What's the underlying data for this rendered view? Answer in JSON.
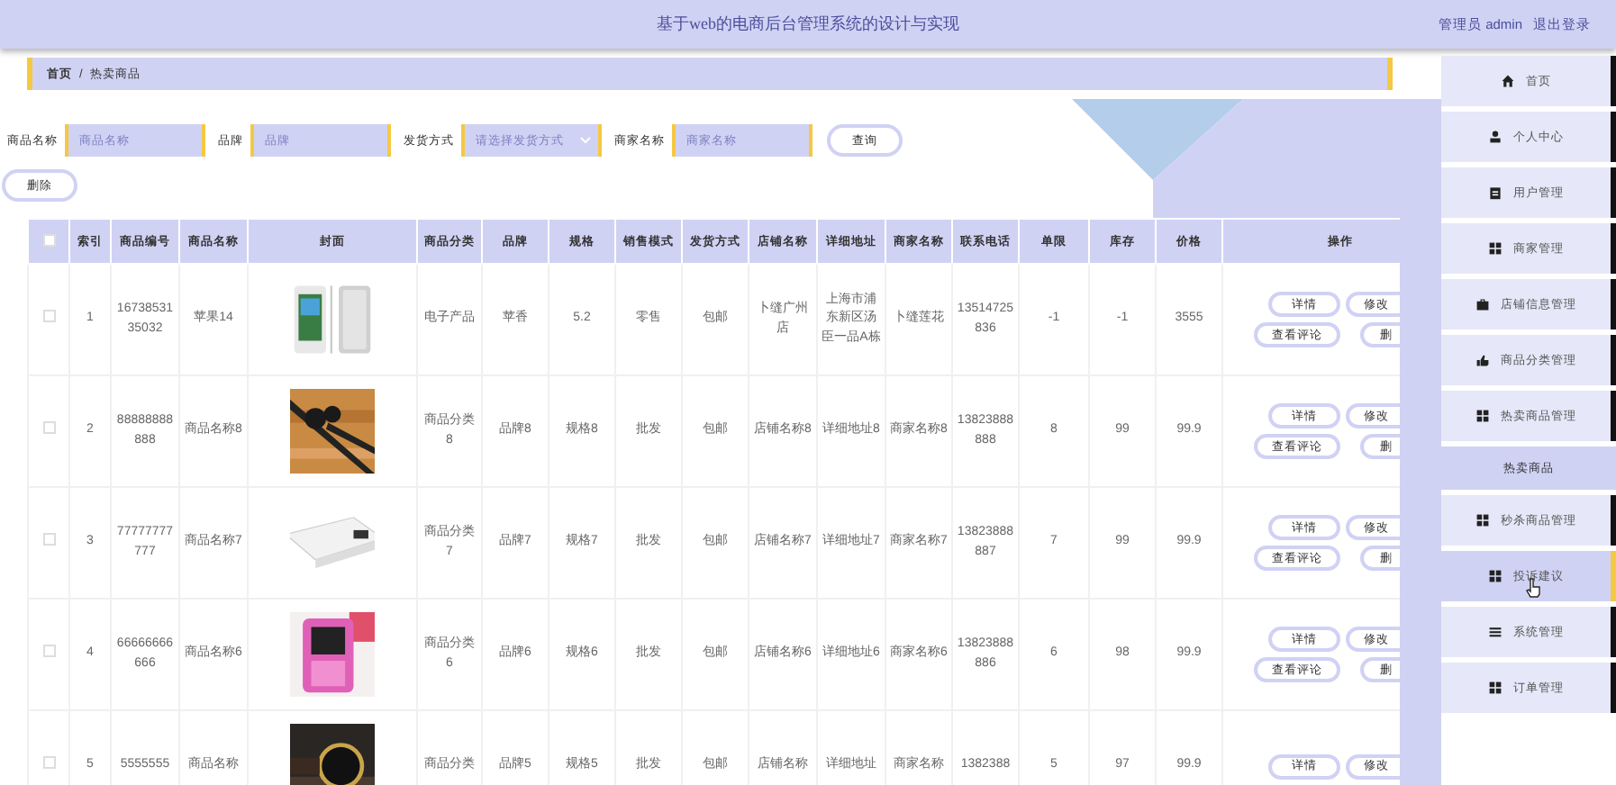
{
  "header": {
    "title": "基于web的电商后台管理系统的设计与实现",
    "user": "管理员 admin",
    "logout": "退出登录"
  },
  "breadcrumb": {
    "home": "首页",
    "separator": "/",
    "current": "热卖商品"
  },
  "search": {
    "fields": [
      {
        "label": "商品名称",
        "placeholder": "商品名称",
        "kind": "input"
      },
      {
        "label": "品牌",
        "placeholder": "品牌",
        "kind": "input"
      },
      {
        "label": "发货方式",
        "placeholder": "请选择发货方式",
        "kind": "select"
      },
      {
        "label": "商家名称",
        "placeholder": "商家名称",
        "kind": "input"
      }
    ],
    "button": "查询"
  },
  "delete_button": "删除",
  "table": {
    "all_checked": false,
    "columns": [
      "索引",
      "商品编号",
      "商品名称",
      "封面",
      "商品分类",
      "品牌",
      "规格",
      "销售模式",
      "发货方式",
      "店铺名称",
      "详细地址",
      "商家名称",
      "联系电话",
      "单限",
      "库存",
      "价格",
      "操作"
    ],
    "rows": [
      {
        "checked": false,
        "cells": [
          "1",
          "1673853135032",
          "苹果14",
          {
            "kind": "picture"
          },
          "电子产品",
          "苹香",
          "5.2",
          "零售",
          "包邮",
          "卜缝广州店",
          "上海市浦东新区汤臣一品A栋",
          "卜缝莲花",
          "13514725836",
          "-1",
          "-1",
          "3555"
        ],
        "actions": [
          "详情",
          "修改",
          "查看评论",
          "删"
        ]
      },
      {
        "checked": false,
        "cells": [
          "2",
          "88888888888",
          "商品名称8",
          {
            "kind": "picture"
          },
          "商品分类8",
          "品牌8",
          "规格8",
          "批发",
          "包邮",
          "店铺名称8",
          "详细地址8",
          "商家名称8",
          "13823888888",
          "8",
          "99",
          "99.9"
        ],
        "actions": [
          "详情",
          "修改",
          "查看评论",
          "删"
        ]
      },
      {
        "checked": false,
        "cells": [
          "3",
          "77777777777",
          "商品名称7",
          {
            "kind": "picture"
          },
          "商品分类7",
          "品牌7",
          "规格7",
          "批发",
          "包邮",
          "店铺名称7",
          "详细地址7",
          "商家名称7",
          "13823888887",
          "7",
          "99",
          "99.9"
        ],
        "actions": [
          "详情",
          "修改",
          "查看评论",
          "删"
        ]
      },
      {
        "checked": false,
        "cells": [
          "4",
          "66666666666",
          "商品名称6",
          {
            "kind": "picture"
          },
          "商品分类6",
          "品牌6",
          "规格6",
          "批发",
          "包邮",
          "店铺名称6",
          "详细地址6",
          "商家名称6",
          "13823888886",
          "6",
          "98",
          "99.9"
        ],
        "actions": [
          "详情",
          "修改",
          "查看评论",
          "删"
        ]
      },
      {
        "checked": false,
        "cells": [
          "5",
          "5555555",
          "商品名称",
          {
            "kind": "picture"
          },
          "商品分类",
          "品牌5",
          "规格5",
          "批发",
          "包邮",
          "店铺名称",
          "详细地址",
          "商家名称",
          "1382388",
          "5",
          "97",
          "99.9"
        ],
        "actions": [
          "详情",
          "修改"
        ]
      }
    ]
  },
  "sidebar": {
    "items": [
      {
        "label": "首页",
        "hovered": false
      },
      {
        "label": "个人中心",
        "hovered": false
      },
      {
        "label": "用户管理",
        "hovered": false
      },
      {
        "label": "商家管理",
        "hovered": false
      },
      {
        "label": "店铺信息管理",
        "hovered": false
      },
      {
        "label": "商品分类管理",
        "hovered": false
      },
      {
        "label": "热卖商品管理",
        "hovered": false,
        "children": [
          {
            "label": "热卖商品",
            "selected": true
          }
        ]
      },
      {
        "label": "秒杀商品管理",
        "hovered": false
      },
      {
        "label": "投诉建议",
        "hovered": true
      },
      {
        "label": "系统管理",
        "hovered": false
      },
      {
        "label": "订单管理",
        "hovered": false
      }
    ]
  }
}
